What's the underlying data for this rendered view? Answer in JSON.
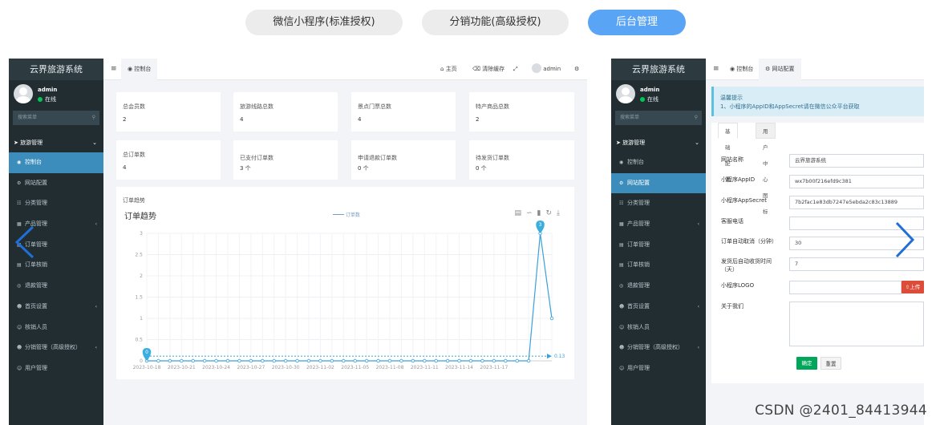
{
  "top_tabs": [
    {
      "label": "微信小程序(标准授权)",
      "active": false
    },
    {
      "label": "分销功能(高级授权)",
      "active": false
    },
    {
      "label": "后台管理",
      "active": true
    }
  ],
  "left_panel": {
    "sidebar": {
      "title": "云界旅游系统",
      "user": "admin",
      "status": "在线",
      "search_placeholder": "搜索菜单",
      "group": "旅游管理",
      "items": [
        {
          "label": "控制台",
          "icon": "dashboard-icon",
          "active": true,
          "chev": false
        },
        {
          "label": "网站配置",
          "icon": "gear-icon",
          "active": false,
          "chev": false
        },
        {
          "label": "分类管理",
          "icon": "sitemap-icon",
          "active": false,
          "chev": false
        },
        {
          "label": "产品管理",
          "icon": "building-icon",
          "active": false,
          "chev": true
        },
        {
          "label": "订单管理",
          "icon": "file-icon",
          "active": false,
          "chev": false
        },
        {
          "label": "订单核销",
          "icon": "file-icon",
          "active": false,
          "chev": false
        },
        {
          "label": "退款管理",
          "icon": "eye-icon",
          "active": false,
          "chev": false
        },
        {
          "label": "首页设置",
          "icon": "users-icon",
          "active": false,
          "chev": true
        },
        {
          "label": "核销人员",
          "icon": "user-icon",
          "active": false,
          "chev": false
        },
        {
          "label": "分销管理（高级授权）",
          "icon": "users-icon",
          "active": false,
          "chev": true
        },
        {
          "label": "用户管理",
          "icon": "user-icon",
          "active": false,
          "chev": false
        }
      ]
    },
    "navbar": {
      "menu_icon": "≡",
      "tab": "控制台",
      "home": "主页",
      "clear_cache": "清除缓存",
      "user": "admin"
    },
    "stats": [
      {
        "title": "总会员数",
        "value": "2"
      },
      {
        "title": "旅游线路总数",
        "value": "4"
      },
      {
        "title": "景点门票总数",
        "value": "4"
      },
      {
        "title": "特产商品总数",
        "value": "2"
      },
      {
        "title": "总订单数",
        "value": "4"
      },
      {
        "title": "已支付订单数",
        "value": "3 个"
      },
      {
        "title": "申请退款订单数",
        "value": "0 个"
      },
      {
        "title": "待发货订单数",
        "value": "0 个"
      }
    ],
    "chart_card": {
      "header": "订单趋势",
      "title": "订单趋势",
      "legend": "订单数"
    }
  },
  "chart_data": {
    "type": "line",
    "title": "订单趋势",
    "series": [
      {
        "name": "订单数",
        "values": [
          0,
          0,
          0,
          0,
          0,
          0,
          0,
          0,
          0,
          0,
          0,
          0,
          0,
          0,
          0,
          0,
          0,
          0,
          0,
          0,
          0,
          0,
          0,
          0,
          0,
          0,
          0,
          0,
          0,
          0,
          0,
          0,
          0,
          0,
          3,
          1
        ]
      }
    ],
    "x": [
      "2023-10-18",
      "2023-10-19",
      "2023-10-20",
      "2023-10-21",
      "2023-10-22",
      "2023-10-23",
      "2023-10-24",
      "2023-10-25",
      "2023-10-26",
      "2023-10-27",
      "2023-10-28",
      "2023-10-29",
      "2023-10-30",
      "2023-10-31",
      "2023-11-01",
      "2023-11-02",
      "2023-11-03",
      "2023-11-04",
      "2023-11-05",
      "2023-11-06",
      "2023-11-07",
      "2023-11-08",
      "2023-11-09",
      "2023-11-10",
      "2023-11-11",
      "2023-11-12",
      "2023-11-13",
      "2023-11-14",
      "2023-11-15",
      "2023-11-16",
      "2023-11-17",
      "2023-11-18",
      "2023-11-19",
      "2023-11-20",
      "2023-11-21",
      "2023-11-22"
    ],
    "x_ticks": [
      "2023-10-18",
      "2023-10-21",
      "2023-10-24",
      "2023-10-27",
      "2023-10-30",
      "2023-11-02",
      "2023-11-05",
      "2023-11-08",
      "2023-11-11",
      "2023-11-14",
      "2023-11-17"
    ],
    "y_ticks": [
      "0",
      "0.5",
      "1",
      "1.5",
      "2",
      "2.5",
      "3"
    ],
    "ylim": [
      0,
      3
    ],
    "grid": true,
    "legend": "top-center",
    "markers": [
      {
        "label": "3",
        "type": "max"
      },
      {
        "label": "0",
        "type": "min"
      }
    ],
    "average_label": "0.13",
    "color": "#3ba0d8"
  },
  "right_panel": {
    "sidebar": {
      "title": "云界旅游系统",
      "user": "admin",
      "status": "在线",
      "search_placeholder": "搜索菜单",
      "group": "旅游管理",
      "items": [
        {
          "label": "控制台",
          "icon": "dashboard-icon",
          "active": false,
          "chev": false
        },
        {
          "label": "网站配置",
          "icon": "gear-icon",
          "active": true,
          "chev": false
        },
        {
          "label": "分类管理",
          "icon": "sitemap-icon",
          "active": false,
          "chev": false
        },
        {
          "label": "产品管理",
          "icon": "building-icon",
          "active": false,
          "chev": true
        },
        {
          "label": "订单管理",
          "icon": "file-icon",
          "active": false,
          "chev": false
        },
        {
          "label": "订单核销",
          "icon": "file-icon",
          "active": false,
          "chev": false
        },
        {
          "label": "退款管理",
          "icon": "eye-icon",
          "active": false,
          "chev": false
        },
        {
          "label": "首页设置",
          "icon": "users-icon",
          "active": false,
          "chev": true
        },
        {
          "label": "核销人员",
          "icon": "user-icon",
          "active": false,
          "chev": false
        },
        {
          "label": "分销管理（高级授权）",
          "icon": "users-icon",
          "active": false,
          "chev": true
        },
        {
          "label": "用户管理",
          "icon": "user-icon",
          "active": false,
          "chev": false
        }
      ]
    },
    "navbar": {
      "menu_icon": "≡",
      "tab1": "控制台",
      "tab2": "网站配置"
    },
    "alert": {
      "title": "温馨提示",
      "text": "1、小程序的AppID和AppSecret请在微信公众平台获取"
    },
    "form": {
      "tabs": [
        "基础配置",
        "用户中心图标"
      ],
      "fields": [
        {
          "label": "网站名称",
          "value": "云界旅游系统"
        },
        {
          "label": "小程序AppID",
          "value": "wx7b00f216efd9c381"
        },
        {
          "label": "小程序AppSecret",
          "value": "7b2fac1e83db7247e5ebda2c83c13889"
        },
        {
          "label": "客服电话",
          "value": ""
        },
        {
          "label": "订单自动取消（分钟）",
          "value": "30"
        },
        {
          "label": "发货后自动收货时间（天）",
          "value": "7"
        },
        {
          "label": "小程序LOGO",
          "value": ""
        },
        {
          "label": "关于我们",
          "value": ""
        }
      ],
      "upload_label": "上传",
      "confirm": "确定",
      "reset": "重置"
    }
  },
  "watermark": "CSDN @2401_84413944",
  "accent": "#3c8dbc"
}
